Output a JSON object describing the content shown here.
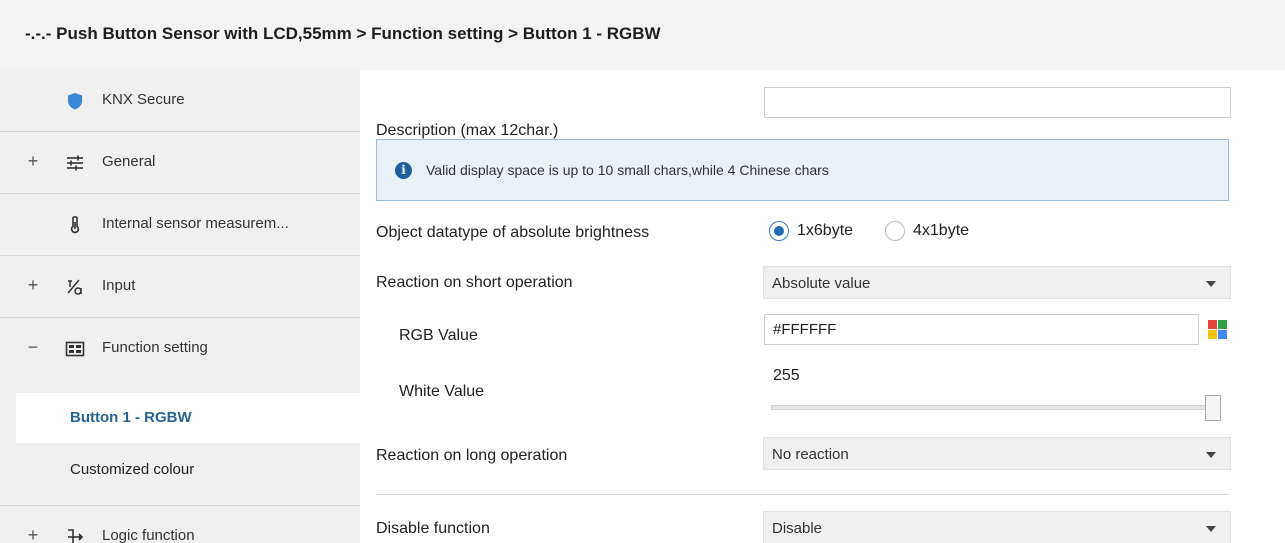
{
  "header": {
    "title": "-.-.- Push Button Sensor with LCD,55mm > Function setting > Button 1 - RGBW"
  },
  "sidebar": {
    "items": [
      {
        "label": "KNX Secure",
        "expander": "",
        "icon": "shield-icon"
      },
      {
        "label": "General",
        "expander": "+",
        "icon": "sliders-icon"
      },
      {
        "label": "Internal sensor measurem...",
        "expander": "",
        "icon": "thermometer-icon"
      },
      {
        "label": "Input",
        "expander": "+",
        "icon": "input-icon"
      },
      {
        "label": "Function setting",
        "expander": "−",
        "icon": "function-icon"
      },
      {
        "label": "Logic function",
        "expander": "+",
        "icon": "logic-icon"
      }
    ],
    "subitems": [
      {
        "label": "Button 1 - RGBW",
        "active": true
      },
      {
        "label": "Customized colour",
        "active": false
      }
    ]
  },
  "main": {
    "description": {
      "label": "Description (max 12char.)",
      "value": ""
    },
    "info": {
      "text": "Valid display space is up to 10 small chars,while 4 Chinese chars"
    },
    "datatype": {
      "label": "Object datatype of absolute brightness",
      "options": [
        "1x6byte",
        "4x1byte"
      ],
      "selected": "1x6byte"
    },
    "short_operation": {
      "label": "Reaction on short operation",
      "value": "Absolute value"
    },
    "rgb": {
      "label": "RGB Value",
      "value": "#FFFFFF"
    },
    "white": {
      "label": "White Value",
      "value": "255",
      "level": 255,
      "max": 255
    },
    "long_operation": {
      "label": "Reaction on long operation",
      "value": "No reaction"
    },
    "disable": {
      "label": "Disable function",
      "value": "Disable"
    }
  },
  "colors": {
    "accent": "#1f6cb0",
    "active_text": "#2a6496",
    "info_bg": "#e9f1f8",
    "palette": [
      "#e8453c",
      "#2f9e44",
      "#f4c20d",
      "#4285f4"
    ]
  }
}
